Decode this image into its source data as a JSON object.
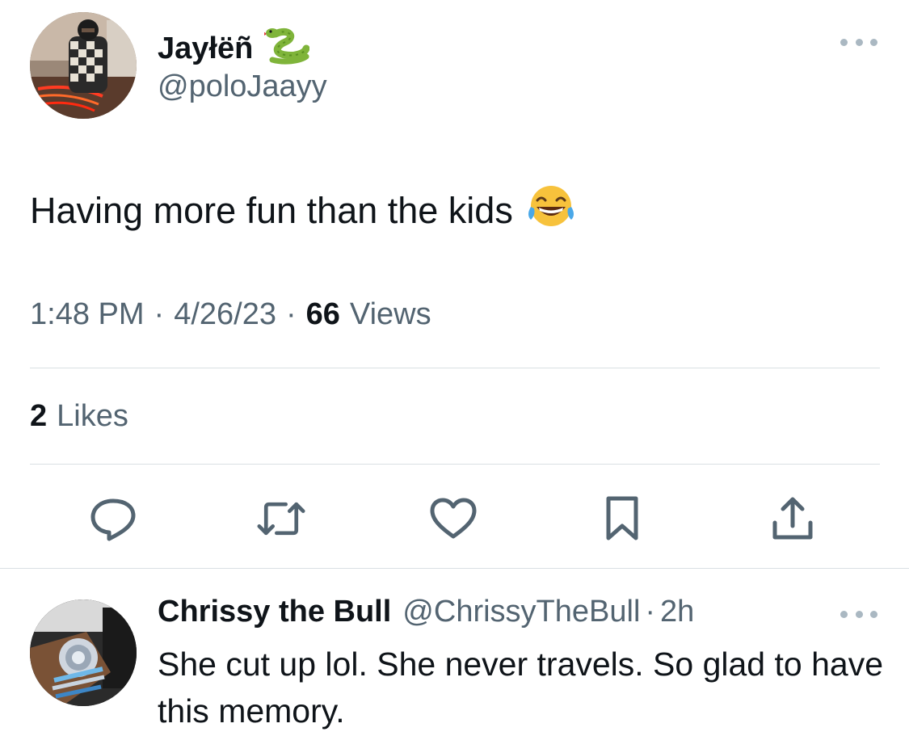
{
  "tweet": {
    "author_name": "Jayłëñ",
    "author_name_emoji": "snake-emoji",
    "handle": "@poloJaayy",
    "text": "Having more fun than the kids",
    "text_emoji": "face-with-tears-of-joy-emoji",
    "time": "1:48 PM",
    "separator": "·",
    "date": "4/26/23",
    "views_count": "66",
    "views_label": "Views",
    "likes_count": "2",
    "likes_label": "Likes",
    "more_icon": "more-horizontal-icon"
  },
  "actions": [
    {
      "name": "reply",
      "icon": "reply-icon"
    },
    {
      "name": "retweet",
      "icon": "retweet-icon"
    },
    {
      "name": "like",
      "icon": "heart-icon"
    },
    {
      "name": "bookmark",
      "icon": "bookmark-icon"
    },
    {
      "name": "share",
      "icon": "share-icon"
    }
  ],
  "reply": {
    "author_name": "Chrissy the Bull",
    "handle": "@ChrissyTheBull",
    "separator": "·",
    "time": "2h",
    "text": "She cut up lol. She never travels. So glad to have this memory."
  },
  "colors": {
    "text_primary": "#0f1419",
    "text_secondary": "#536471",
    "icon": "#536471",
    "divider": "#dadfe3"
  }
}
